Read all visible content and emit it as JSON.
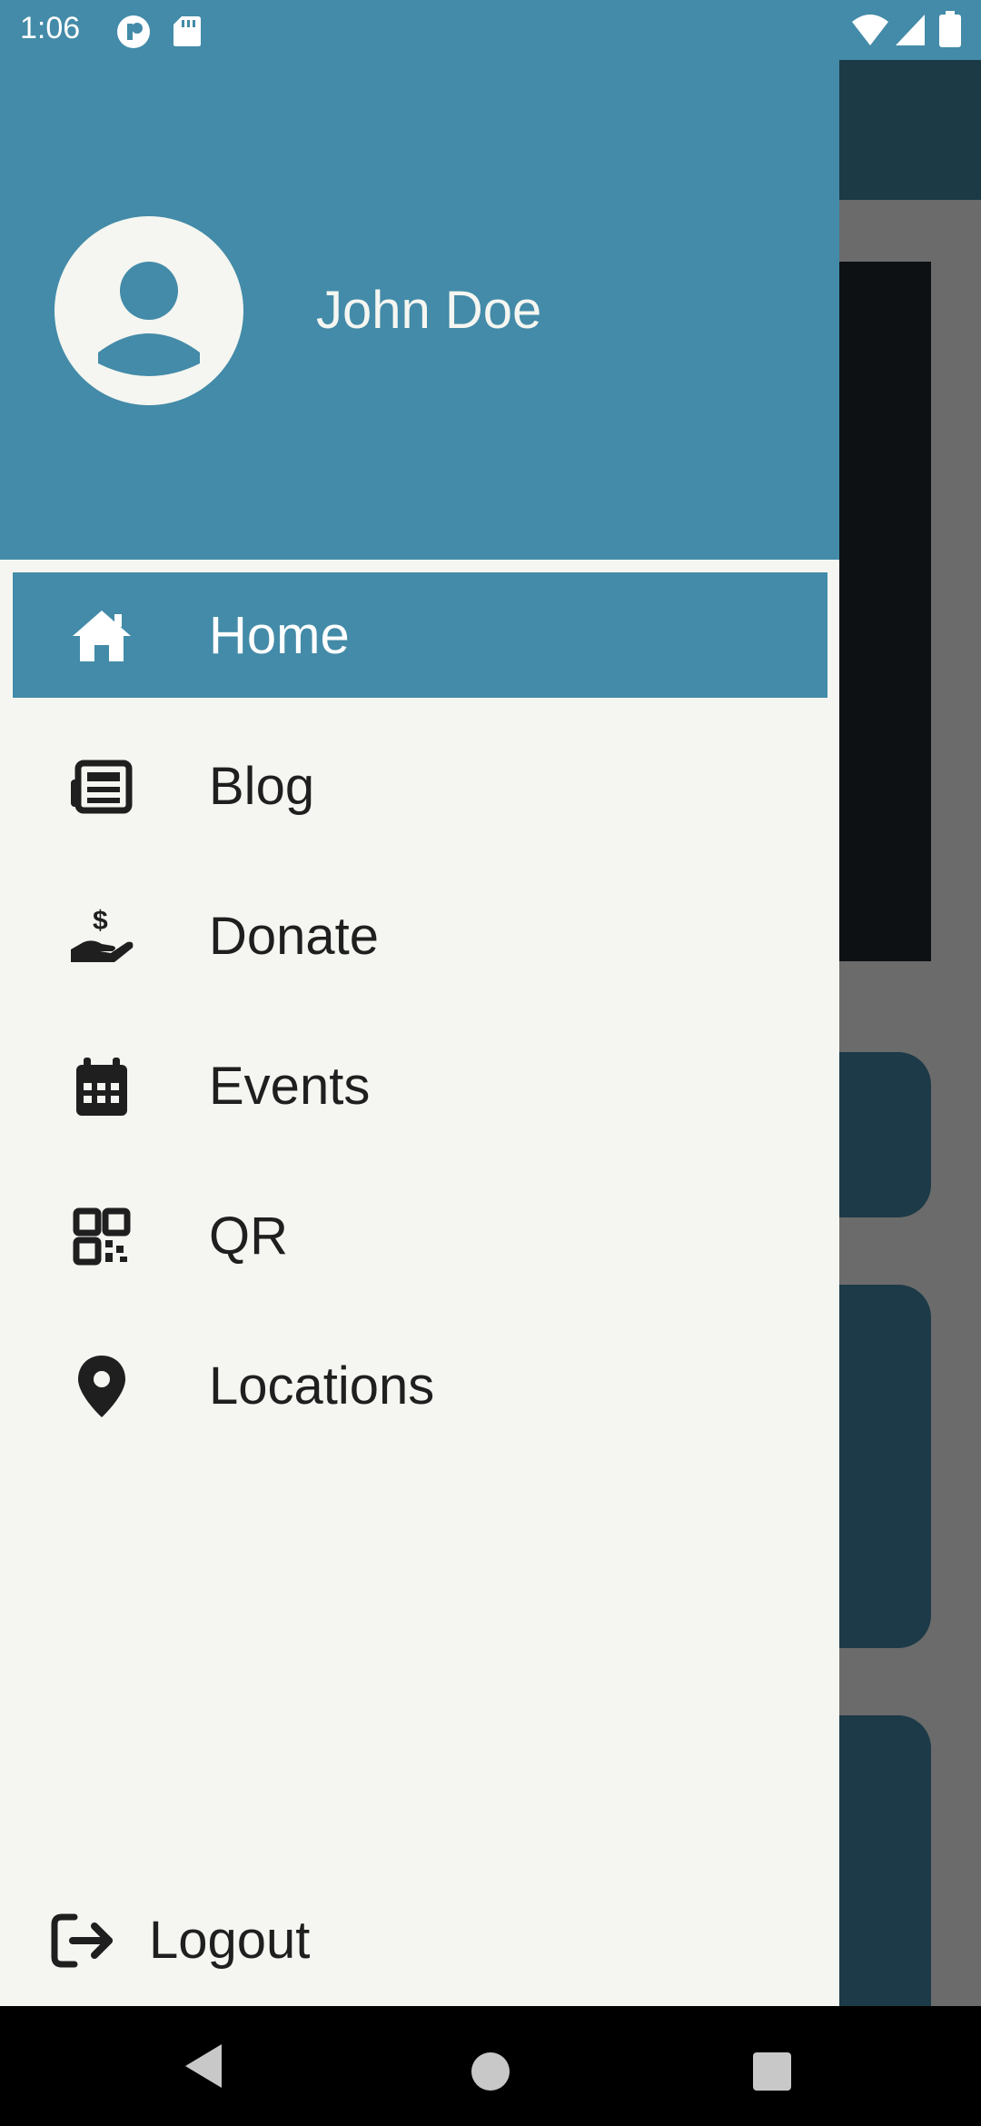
{
  "status_bar": {
    "time": "1:06",
    "icons": [
      "app-notification-icon",
      "sd-card-icon",
      "wifi-icon",
      "cell-signal-icon",
      "battery-icon"
    ]
  },
  "drawer": {
    "user_name": "John Doe",
    "items": [
      {
        "label": "Home",
        "icon": "home-icon",
        "active": true
      },
      {
        "label": "Blog",
        "icon": "newspaper-icon",
        "active": false
      },
      {
        "label": "Donate",
        "icon": "donate-hand-icon",
        "active": false
      },
      {
        "label": "Events",
        "icon": "calendar-icon",
        "active": false
      },
      {
        "label": "QR",
        "icon": "qr-code-icon",
        "active": false
      },
      {
        "label": "Locations",
        "icon": "location-pin-icon",
        "active": false
      }
    ],
    "logout_label": "Logout"
  },
  "colors": {
    "accent": "#438ba8",
    "drawer_bg": "#f5f6f1",
    "text": "#1f1f1f",
    "appbar_dark": "#1b3a46"
  },
  "nav_bar": {
    "buttons": [
      "back-icon",
      "home-circle-icon",
      "recents-icon"
    ]
  }
}
